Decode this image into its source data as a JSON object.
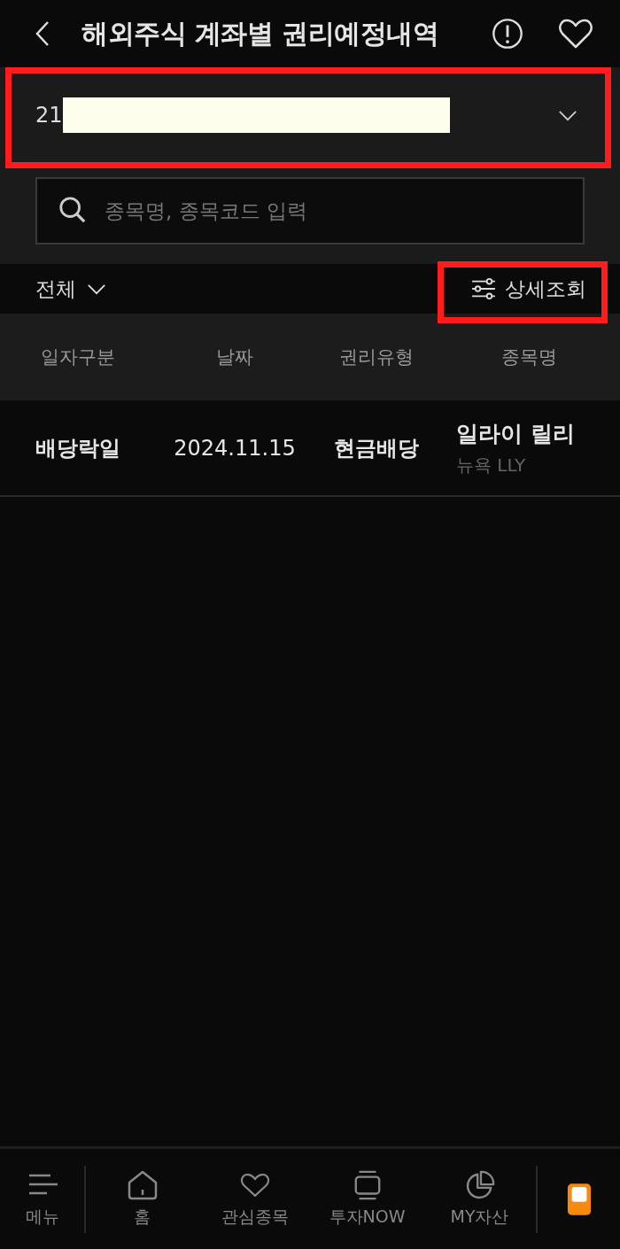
{
  "header": {
    "title": "해외주식 계좌별 권리예정내역"
  },
  "account": {
    "value": "21"
  },
  "search": {
    "placeholder": "종목명, 종목코드 입력"
  },
  "filter": {
    "label": "전체",
    "detail_button": "상세조회"
  },
  "table": {
    "columns": [
      "일자구분",
      "날짜",
      "권리유형",
      "종목명"
    ],
    "rows": [
      {
        "date_type": "배당락일",
        "date": "2024.11.15",
        "right_type": "현금배당",
        "stock_name": "일라이 릴리",
        "market": "뉴욕 LLY"
      }
    ]
  },
  "bottom_nav": [
    {
      "kind": "menu",
      "label": "메뉴"
    },
    {
      "kind": "home",
      "label": "홈"
    },
    {
      "kind": "heart",
      "label": "관심종목"
    },
    {
      "kind": "now",
      "label": "투자NOW"
    },
    {
      "kind": "pie",
      "label": "MY자산"
    },
    {
      "kind": "app"
    }
  ]
}
